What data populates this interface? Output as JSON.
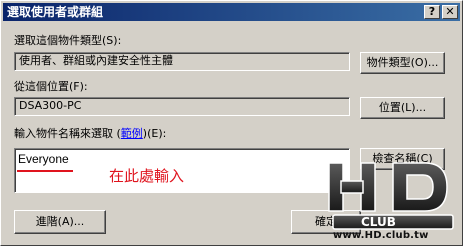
{
  "window": {
    "title": "選取使用者或群組",
    "help_button": "?",
    "close_button": "✕"
  },
  "object_type": {
    "label": "選取這個物件類型(S):",
    "value": "使用者、群組或內建安全性主體",
    "button": "物件類型(O)..."
  },
  "location": {
    "label": "從這個位置(F):",
    "value": "DSA300-PC",
    "button": "位置(L)..."
  },
  "names": {
    "label_prefix": "輸入物件名稱來選取 (",
    "label_link": "範例",
    "label_suffix": ")(E):",
    "entered_text": "Everyone",
    "annotation": "在此處輸入",
    "check_button": "檢查名稱(C)"
  },
  "footer": {
    "advanced_button": "進階(A)...",
    "ok_button": "確定"
  },
  "watermark": {
    "logo_text": "HD CLUB",
    "url": "www.HD.club.tw"
  },
  "colors": {
    "titlebar_start": "#0a246a",
    "titlebar_end": "#3a6ea5",
    "annotation": "#e0141e",
    "face": "#d4d0c8"
  }
}
